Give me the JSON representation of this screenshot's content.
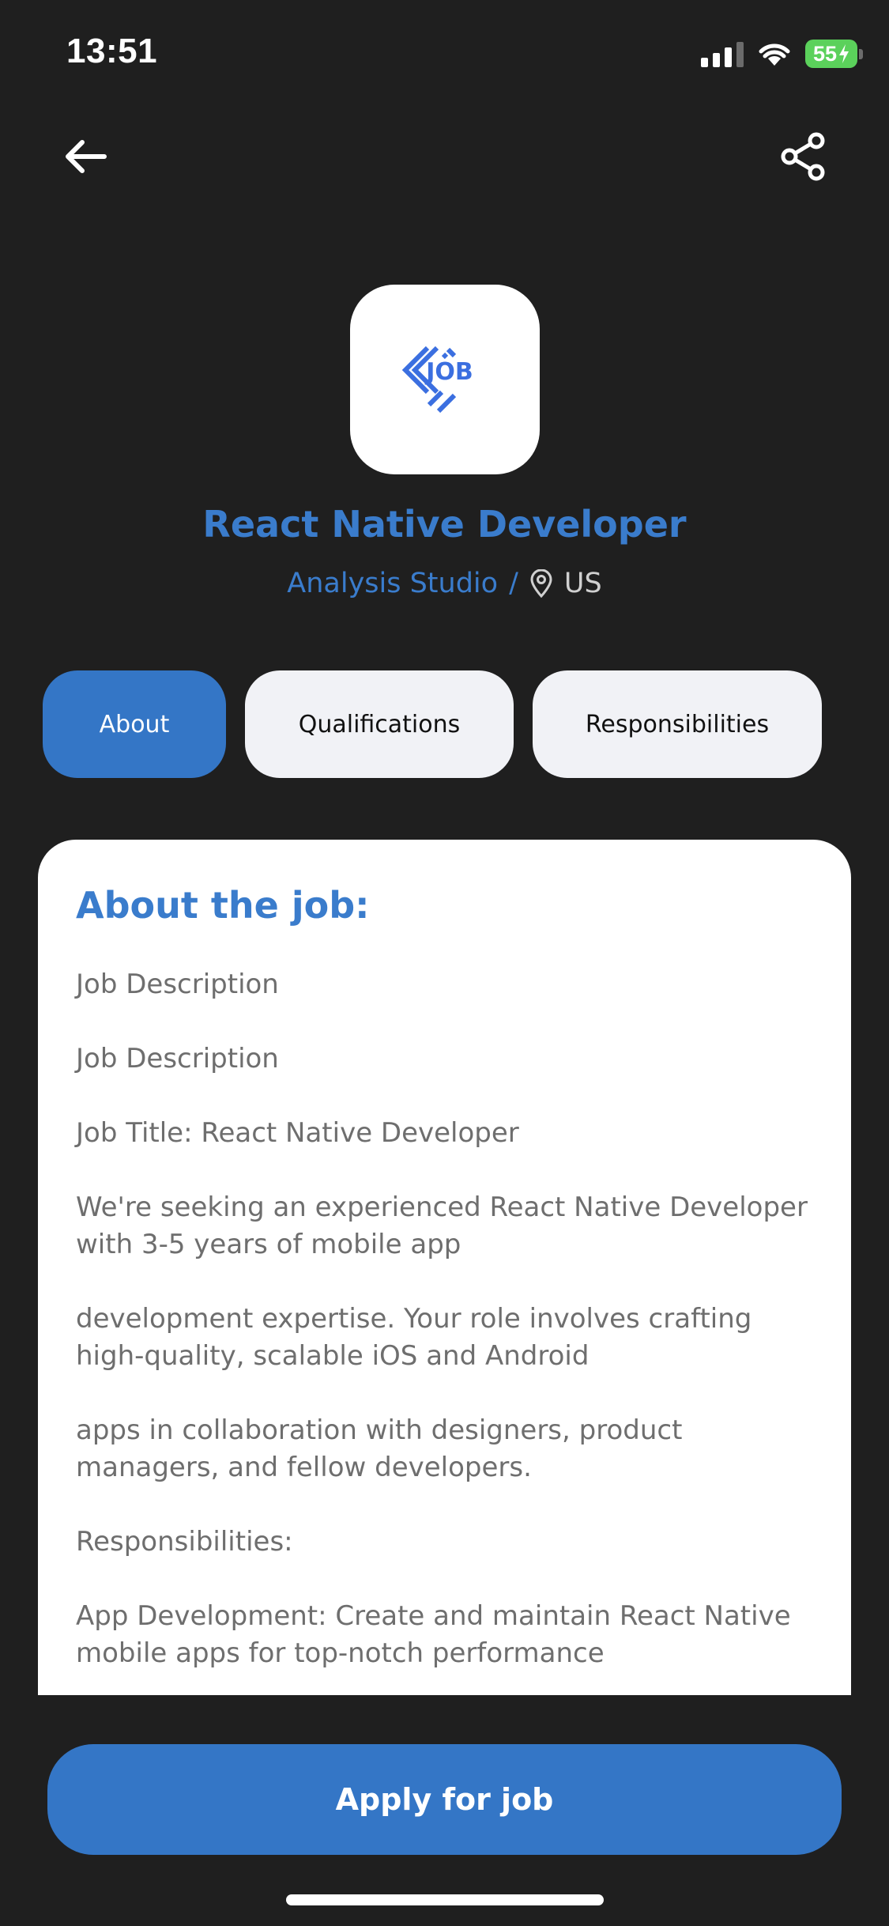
{
  "status_bar": {
    "time": "13:51",
    "battery": "55"
  },
  "header": {
    "back_icon": "arrow-left-icon",
    "share_icon": "share-icon"
  },
  "job": {
    "logo_text": "JOB",
    "title": "React Native Developer",
    "company": "Analysis Studio",
    "separator": "/",
    "location": "US"
  },
  "tabs": [
    {
      "label": "About",
      "active": true
    },
    {
      "label": "Qualifications",
      "active": false
    },
    {
      "label": "Responsibilities",
      "active": false
    }
  ],
  "about": {
    "heading": "About the job:",
    "paragraphs": [
      "Job Description",
      "Job Description",
      "Job Title: React Native Developer",
      "We're seeking an experienced React Native Developer with 3-5 years of mobile app",
      "development expertise. Your role involves crafting high-quality, scalable iOS and Android",
      "apps in collaboration with designers, product managers, and fellow developers.",
      "Responsibilities:",
      "App Development: Create and maintain React Native mobile apps for top-notch performance"
    ]
  },
  "footer": {
    "apply_label": "Apply for job"
  },
  "colors": {
    "background": "#1f1f1f",
    "accent": "#3476c6",
    "title_blue": "#3a7ccc",
    "tab_inactive": "#f1f2f6"
  }
}
